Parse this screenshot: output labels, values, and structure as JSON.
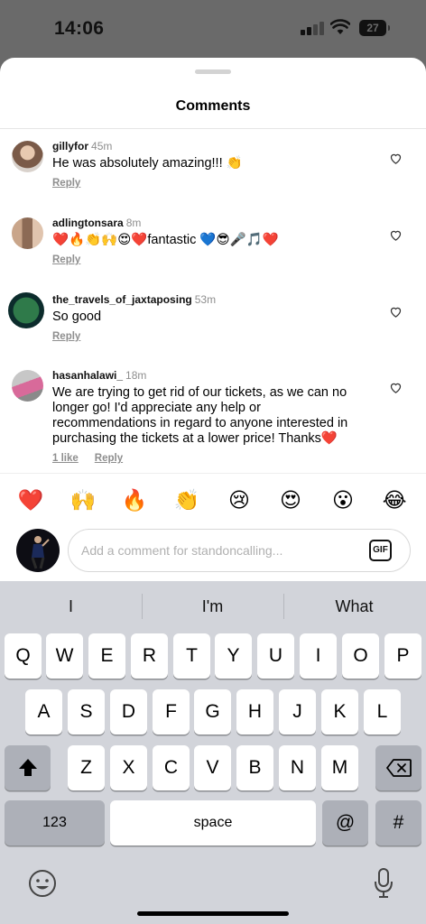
{
  "status_bar": {
    "time": "14:06",
    "battery": "27"
  },
  "sheet": {
    "title": "Comments"
  },
  "comments": [
    {
      "user": "gillyfor",
      "time": "45m",
      "text": "He was absolutely amazing!!! 👏",
      "actions": [
        "Reply"
      ]
    },
    {
      "user": "adlingtonsara",
      "time": "8m",
      "text": "❤️🔥👏🙌😍❤️fantastic 💙😎🎤🎵❤️",
      "actions": [
        "Reply"
      ]
    },
    {
      "user": "the_travels_of_jaxtaposing",
      "time": "53m",
      "text": "So good",
      "actions": [
        "Reply"
      ]
    },
    {
      "user": "hasanhalawi_",
      "time": "18m",
      "text": "We are trying to get rid of our tickets, as we can no longer go! I'd appreciate any help or recommendations in regard to anyone interested in purchasing the tickets at a lower price! Thanks❤️",
      "actions": [
        "1 like",
        "Reply"
      ]
    }
  ],
  "quick_reactions": [
    "❤️",
    "🙌",
    "🔥",
    "👏",
    "😢",
    "😍",
    "😮",
    "😂"
  ],
  "comment_input": {
    "placeholder": "Add a comment for standoncalling...",
    "gif_label": "GIF"
  },
  "keyboard": {
    "suggestions": [
      "I",
      "I'm",
      "What"
    ],
    "row1": [
      "Q",
      "W",
      "E",
      "R",
      "T",
      "Y",
      "U",
      "I",
      "O",
      "P"
    ],
    "row2": [
      "A",
      "S",
      "D",
      "F",
      "G",
      "H",
      "J",
      "K",
      "L"
    ],
    "row3": [
      "Z",
      "X",
      "C",
      "V",
      "B",
      "N",
      "M"
    ],
    "numbers_label": "123",
    "space_label": "space",
    "at_label": "@",
    "hash_label": "#"
  },
  "icons": [
    "heart-outline-icon",
    "shift-icon",
    "delete-icon",
    "emoji-icon",
    "microphone-icon",
    "signal-icon",
    "wifi-icon"
  ]
}
